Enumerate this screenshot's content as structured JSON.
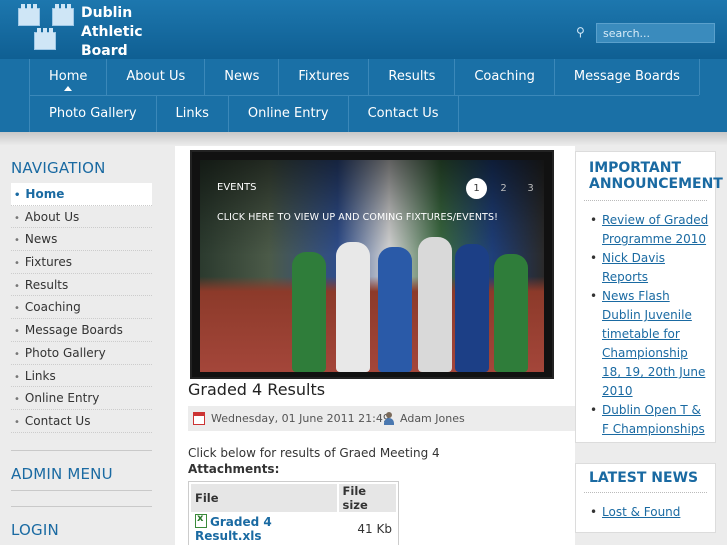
{
  "site": {
    "logo_lines": [
      "Dublin",
      "Athletic",
      "Board"
    ],
    "logo_icon": "castle-icon"
  },
  "search": {
    "placeholder": "search...",
    "icon": "search-icon"
  },
  "nav": {
    "row1": [
      "Home",
      "About Us",
      "News",
      "Fixtures",
      "Results",
      "Coaching",
      "Message Boards"
    ],
    "row2": [
      "Photo Gallery",
      "Links",
      "Online Entry",
      "Contact Us"
    ],
    "active": "Home"
  },
  "sidebar": {
    "navigation_heading": "NAVIGATION",
    "items": [
      "Home",
      "About Us",
      "News",
      "Fixtures",
      "Results",
      "Coaching",
      "Message Boards",
      "Photo Gallery",
      "Links",
      "Online Entry",
      "Contact Us"
    ],
    "admin_heading": "ADMIN MENU",
    "login_heading": "LOGIN"
  },
  "slider": {
    "tag": "EVENTS",
    "caption": "CLICK HERE TO VIEW UP AND COMING FIXTURES/EVENTS!",
    "pages": [
      "1",
      "2",
      "3"
    ],
    "current": 1
  },
  "article": {
    "title": "Graded 4 Results",
    "date": "Wednesday, 01 June 2011 21:49",
    "author": "Adam Jones",
    "intro": "Click below for results of Graed Meeting 4",
    "attachments_label": "Attachments:",
    "table_headers": [
      "File",
      "File size"
    ],
    "files": [
      {
        "name": "Graded 4 Result.xls",
        "size": "41 Kb"
      }
    ]
  },
  "announcements": {
    "title_line1": "IMPORTANT",
    "title_line2": "ANNOUNCEMENT",
    "items": [
      [
        "Review of Graded",
        "Programme 2010"
      ],
      [
        "Nick Davis",
        "Reports"
      ],
      [
        "News Flash",
        "Dublin Juvenile",
        "timetable for",
        "Championship",
        "18, 19, 20th June",
        "2010"
      ],
      [
        "Dublin Open T &",
        "F Championships"
      ]
    ]
  },
  "latest_news": {
    "title": "LATEST NEWS",
    "items": [
      "Lost & Found"
    ]
  },
  "colors": {
    "header": "#1a70a6",
    "accent": "#1a6aa2",
    "sidebar_bg": "#ececec"
  }
}
